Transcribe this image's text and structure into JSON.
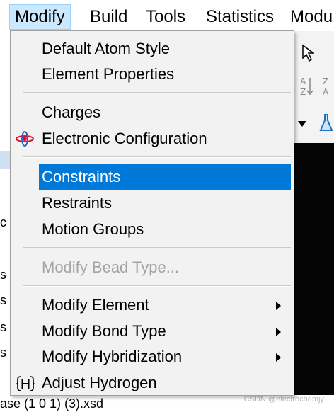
{
  "menubar": {
    "items": [
      "Modify",
      "Build",
      "Tools",
      "Statistics",
      "Modu"
    ]
  },
  "menu": {
    "items": [
      {
        "label": "Default Atom Style"
      },
      {
        "label": "Element Properties"
      },
      {
        "label": "Charges"
      },
      {
        "label": "Electronic Configuration",
        "icon": "electron-orbit-icon"
      },
      {
        "label": "Constraints",
        "selected": true
      },
      {
        "label": "Restraints"
      },
      {
        "label": "Motion Groups"
      },
      {
        "label": "Modify Bead Type...",
        "disabled": true
      },
      {
        "label": "Modify Element",
        "submenu": true
      },
      {
        "label": "Modify Bond Type",
        "submenu": true
      },
      {
        "label": "Modify Hybridization",
        "submenu": true
      },
      {
        "label": "Adjust Hydrogen",
        "icon": "hydrogen-icon"
      }
    ]
  },
  "background": {
    "left_fragments": [
      "c",
      "s",
      "s",
      "s",
      "s"
    ],
    "bottom_text": "ase (1 0 1) (3).xsd"
  },
  "watermark": "CSDN @electrochemjy",
  "colors": {
    "selection": "#0078d7",
    "menubar_active": "#cce8ff",
    "disabled_text": "#a3a3a3"
  }
}
